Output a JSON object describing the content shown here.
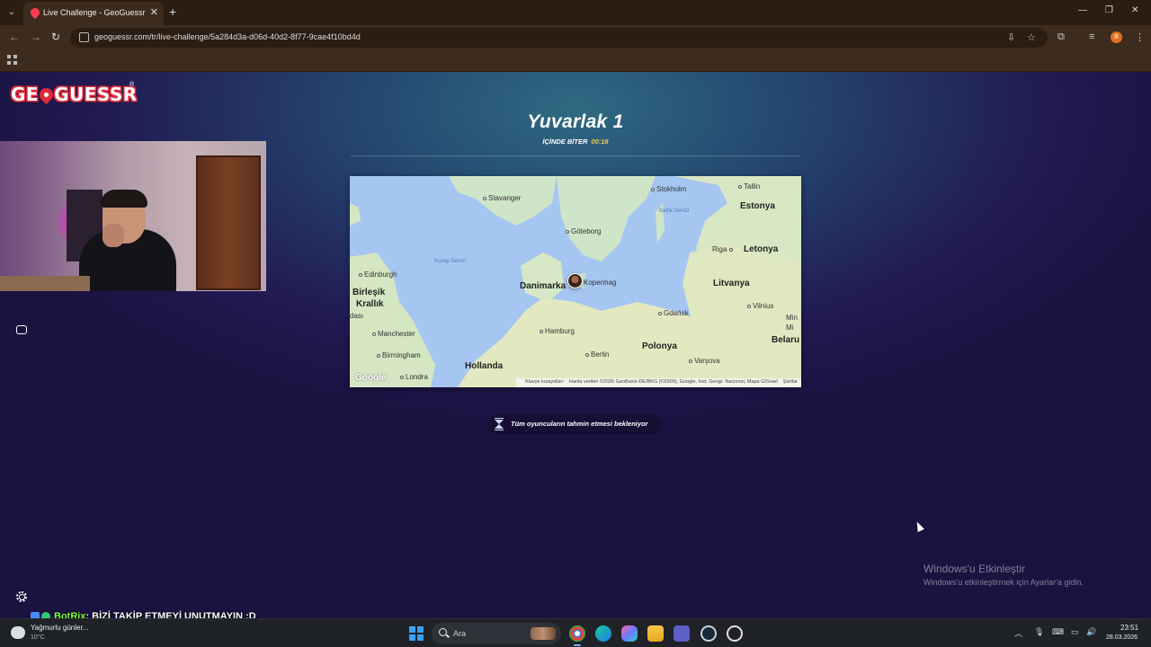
{
  "browser": {
    "tab_title": "Live Challenge - GeoGuessr",
    "url": "geoguessr.com/tr/live-challenge/5a284d3a-d06d-40d2-8f77-9cae4f10bd4d",
    "profile_initial": "B"
  },
  "game": {
    "logo_text_left": "GE",
    "logo_text_right": "GUESSR",
    "round_title": "Yuvarlak 1",
    "timer_label": "İÇİNDE BİTER",
    "timer_value": "00:18",
    "waiting_message": "Tüm oyuncuların tahmin etmesi bekleniyor"
  },
  "map": {
    "labels": {
      "stavanger": "Stavanger",
      "stockholm": "Stokholm",
      "tallin": "Tallin",
      "estonya": "Estonya",
      "baltik": "Baltık Denizi",
      "goteborg": "Göteborg",
      "riga": "Riga",
      "letonya": "Letonya",
      "kuzey": "Kuzey Denizi",
      "edinburgh": "Edinburgh",
      "danimarka": "Danimarka",
      "kopenhag": "Kopenhag",
      "litvanya": "Litvanya",
      "birlesik1": "Birleşik",
      "birlesik2": "Krallık",
      "dasi": "dası",
      "gdansk": "Gdańsk",
      "vilnius": "Vilnius",
      "min": "Min",
      "min2": "Mi",
      "belarus": "Belaru",
      "manchester": "Manchester",
      "hamburg": "Hamburg",
      "polonya": "Polonya",
      "birmingham": "Birmingham",
      "berlin": "Berlin",
      "hollanda": "Hollanda",
      "varsova": "Varşova",
      "londra": "Londra"
    },
    "google": "Google",
    "footer_shortcuts": "Klavye kısayolları",
    "footer_data": "Harita verileri ©2026 GeoBasis-DE/BKG (©2009), Google, Inst. Geogr. Nacional, Mapa GISrael",
    "footer_terms": "Şartlar"
  },
  "overlay": {
    "chat_user": "BotRix",
    "chat_message": ": BİZİ TAKİP ETMEYİ UNUTMAYIN :D",
    "windows_activate_title": "Windows'u Etkinleştir",
    "windows_activate_sub": "Windows'u etkinleştirmek için Ayarlar'a gidin."
  },
  "taskbar": {
    "weather_desc": "Yağmurlu günler...",
    "weather_temp": "10°C",
    "search_placeholder": "Ara",
    "time": "23:51",
    "date": "28.03.2026"
  }
}
